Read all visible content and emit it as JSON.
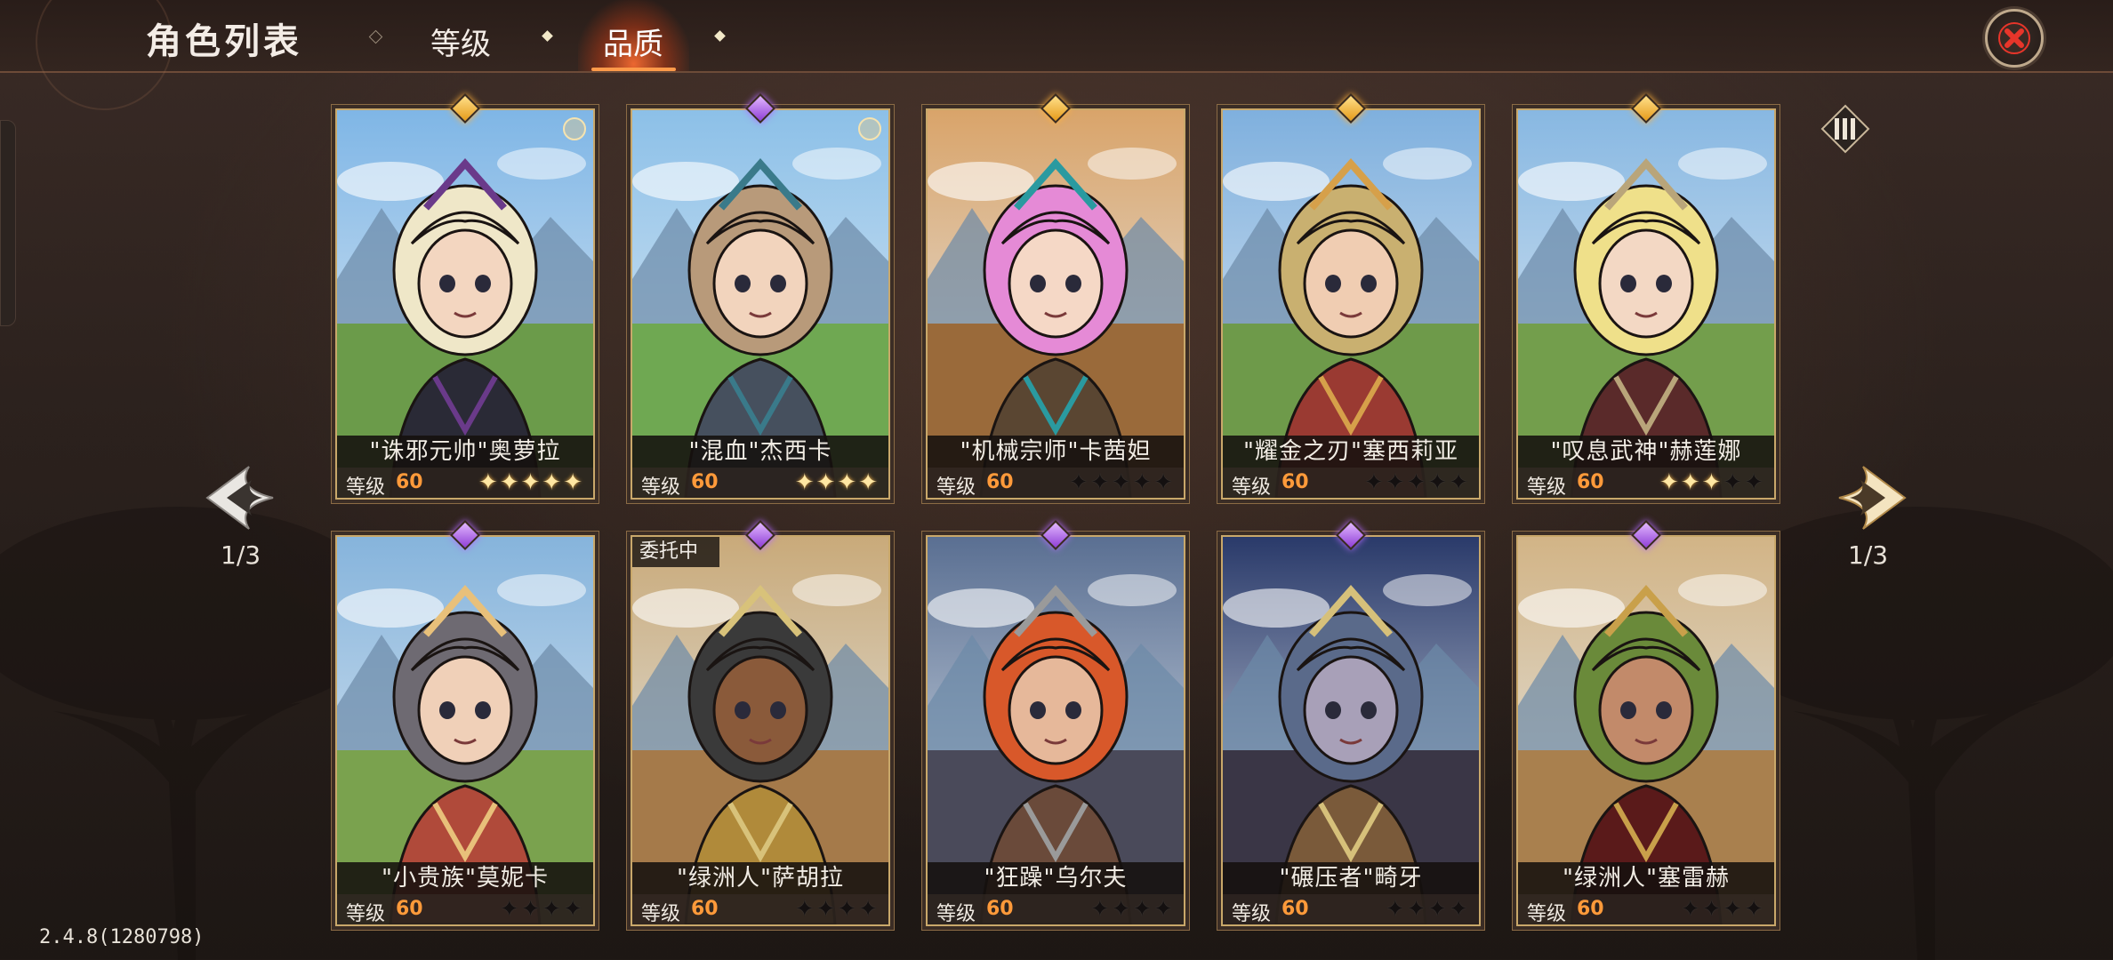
{
  "header": {
    "title": "角色列表",
    "tabs": [
      {
        "label": "等级",
        "active": false
      },
      {
        "label": "品质",
        "active": true
      }
    ]
  },
  "pagination": {
    "left_label": "1/3",
    "right_label": "1/3"
  },
  "version": "2.4.8(1280798)",
  "colors": {
    "level_value": "#ff9a3a",
    "gold_rarity": "#f0a928",
    "purple_rarity": "#b36bff",
    "close_x": "#e8352a"
  },
  "level_label": "等级",
  "cards": [
    {
      "name": "\"诛邪元帅\"奥萝拉",
      "level": "60",
      "stars_filled": 5,
      "stars_total": 5,
      "rarity": "gold",
      "badge": true,
      "status": ""
    },
    {
      "name": "\"混血\"杰西卡",
      "level": "60",
      "stars_filled": 4,
      "stars_total": 4,
      "rarity": "purple",
      "badge": true,
      "status": ""
    },
    {
      "name": "\"机械宗师\"卡茜妲",
      "level": "60",
      "stars_filled": 0,
      "stars_total": 5,
      "rarity": "gold",
      "badge": false,
      "status": ""
    },
    {
      "name": "\"耀金之刃\"塞西莉亚",
      "level": "60",
      "stars_filled": 0,
      "stars_total": 5,
      "rarity": "gold",
      "badge": false,
      "status": ""
    },
    {
      "name": "\"叹息武神\"赫莲娜",
      "level": "60",
      "stars_filled": 3,
      "stars_total": 5,
      "rarity": "gold",
      "badge": false,
      "status": ""
    },
    {
      "name": "\"小贵族\"莫妮卡",
      "level": "60",
      "stars_filled": 0,
      "stars_total": 4,
      "rarity": "purple",
      "badge": false,
      "status": ""
    },
    {
      "name": "\"绿洲人\"萨胡拉",
      "level": "60",
      "stars_filled": 0,
      "stars_total": 4,
      "rarity": "purple",
      "badge": false,
      "status": "委托中"
    },
    {
      "name": "\"狂躁\"乌尔夫",
      "level": "60",
      "stars_filled": 0,
      "stars_total": 4,
      "rarity": "purple",
      "badge": false,
      "status": ""
    },
    {
      "name": "\"碾压者\"畸牙",
      "level": "60",
      "stars_filled": 0,
      "stars_total": 4,
      "rarity": "purple",
      "badge": false,
      "status": ""
    },
    {
      "name": "\"绿洲人\"塞雷赫",
      "level": "60",
      "stars_filled": 0,
      "stars_total": 4,
      "rarity": "purple",
      "badge": false,
      "status": ""
    }
  ],
  "icons": {
    "close": "close-icon",
    "prev": "arrow-left-icon",
    "next": "arrow-right-icon",
    "grid": "grid-view-icon",
    "star": "star-icon"
  }
}
